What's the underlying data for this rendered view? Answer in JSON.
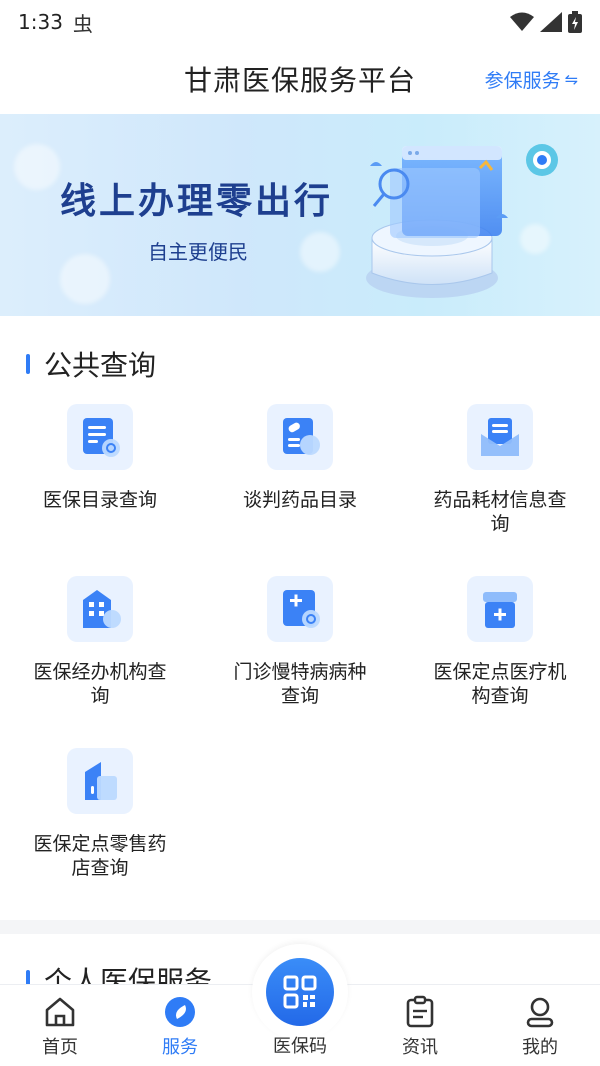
{
  "status_bar": {
    "time": "1:33",
    "notification_glyph": "虫"
  },
  "header": {
    "title": "甘肃医保服务平台",
    "switch_label": "参保服务",
    "switch_glyph": "⇋"
  },
  "banner": {
    "headline": "线上办理零出行",
    "subline": "自主更便民"
  },
  "sections": {
    "public": {
      "title": "公共查询"
    },
    "personal": {
      "title": "个人医保服务"
    }
  },
  "grid": [
    {
      "label": "医保目录查询",
      "icon": "list-search-icon"
    },
    {
      "label": "谈判药品目录",
      "icon": "pill-icon"
    },
    {
      "label": "药品耗材信息查询",
      "icon": "envelope-doc-icon"
    },
    {
      "label": "医保经办机构查询",
      "icon": "building-icon"
    },
    {
      "label": "门诊慢特病病种查询",
      "icon": "medical-search-icon"
    },
    {
      "label": "医保定点医疗机构查询",
      "icon": "medical-box-icon"
    },
    {
      "label": "医保定点零售药店查询",
      "icon": "pharmacy-icon"
    }
  ],
  "tabbar": {
    "home": "首页",
    "service": "服务",
    "qr": "医保码",
    "news": "资讯",
    "mine": "我的"
  },
  "colors": {
    "accent": "#2f7cf6",
    "icon_bg": "#e9f2ff",
    "banner_text": "#1e3f8f"
  }
}
